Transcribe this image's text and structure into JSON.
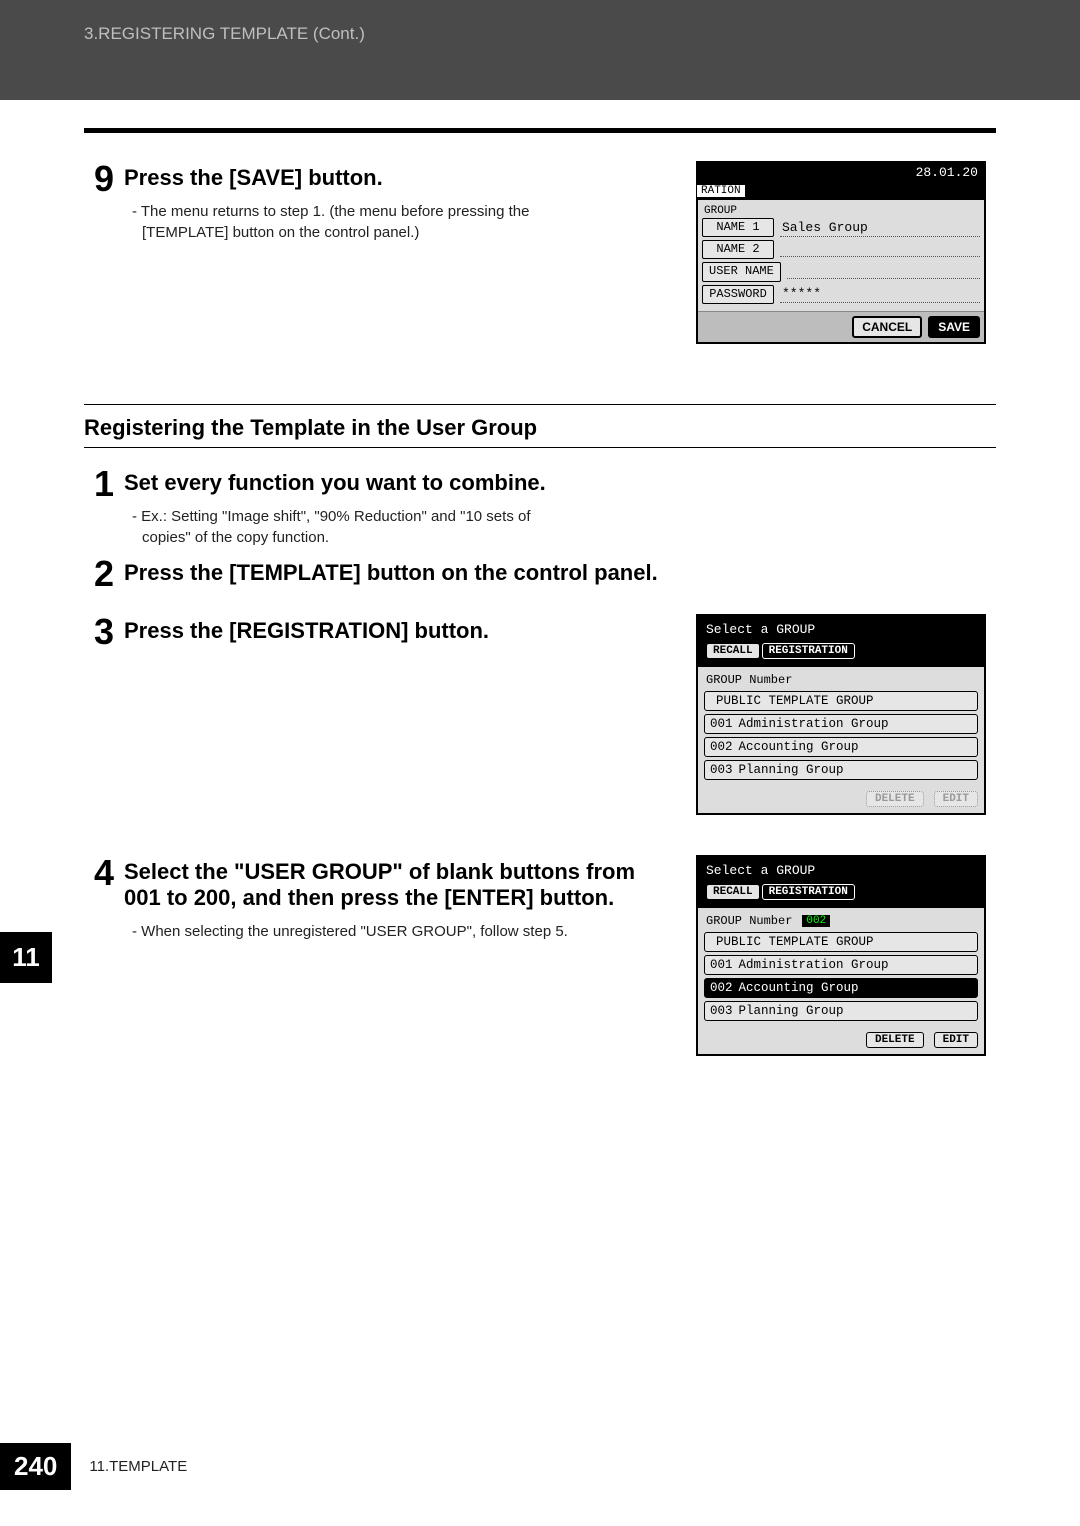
{
  "header": {
    "breadcrumb": "3.REGISTERING TEMPLATE (Cont.)"
  },
  "section9": {
    "title": "Press the [SAVE] button.",
    "note": "- The menu returns to step 1. (the menu before pressing the [TEMPLATE] button on the control panel.)",
    "screen": {
      "date": "28.01.20",
      "tab": "RATION",
      "section_head": "GROUP",
      "fields": {
        "name1_label": "NAME 1",
        "name1_val": "Sales Group",
        "name2_label": "NAME 2",
        "name2_val": "",
        "user_label": "USER NAME",
        "user_val": "",
        "pass_label": "PASSWORD",
        "pass_val": "*****"
      },
      "cancel": "CANCEL",
      "save": "SAVE"
    }
  },
  "subsection_title": "Registering the Template in the User Group",
  "step1": {
    "title": "Set every function you want to combine.",
    "note": "- Ex.: Setting \"Image shift\", \"90% Reduction\" and \"10 sets of copies\" of the copy function."
  },
  "step2": {
    "title": "Press the [TEMPLATE] button on the control panel."
  },
  "step3": {
    "title": "Press the [REGISTRATION] button.",
    "screen": {
      "head": "Select a GROUP",
      "recall": "RECALL",
      "registration": "REGISTRATION",
      "groupnum_label": "GROUP Number",
      "groupnum_val": "",
      "items": [
        {
          "id": "",
          "label": "PUBLIC TEMPLATE GROUP"
        },
        {
          "id": "001",
          "label": "Administration Group"
        },
        {
          "id": "002",
          "label": "Accounting Group"
        },
        {
          "id": "003",
          "label": "Planning Group"
        }
      ],
      "delete": "DELETE",
      "edit": "EDIT"
    }
  },
  "step4": {
    "title": "Select the \"USER GROUP\" of blank buttons from 001 to 200, and then press the [ENTER] button.",
    "note": "- When selecting the unregistered \"USER GROUP\", follow step 5.",
    "screen": {
      "head": "Select a GROUP",
      "recall": "RECALL",
      "registration": "REGISTRATION",
      "groupnum_label": "GROUP Number",
      "groupnum_val": "002",
      "items": [
        {
          "id": "",
          "label": "PUBLIC TEMPLATE GROUP",
          "selected": false
        },
        {
          "id": "001",
          "label": "Administration Group",
          "selected": false
        },
        {
          "id": "002",
          "label": "Accounting Group",
          "selected": true
        },
        {
          "id": "003",
          "label": "Planning Group",
          "selected": false
        }
      ],
      "delete": "DELETE",
      "edit": "EDIT"
    }
  },
  "chapter_tab": "11",
  "footer": {
    "page": "240",
    "chapter": "11.TEMPLATE"
  }
}
